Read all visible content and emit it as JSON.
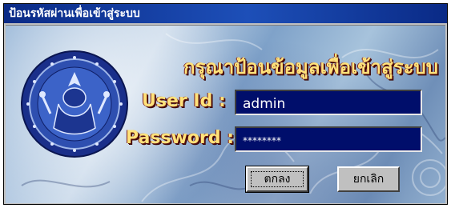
{
  "window": {
    "title": "ป้อนรหัสผ่านเพื่อเข้าสู่ระบบ"
  },
  "login": {
    "heading": "กรุณาป้อนข้อมูลเพื่อเข้าสู่ระบบ",
    "user_id_label": "User Id :",
    "user_id_value": "admin",
    "password_label": "Password :",
    "password_value": "********"
  },
  "buttons": {
    "ok_label": "ตกลง",
    "cancel_label": "ยกเลิก"
  },
  "colors": {
    "titlebar": "#0a2a86",
    "field_bg": "#000e6b",
    "label_text": "#ffe27a",
    "label_shadow": "#5a0e0e",
    "button_face": "#c0c0c0"
  },
  "icons": {
    "seal": "department-seal-icon"
  }
}
